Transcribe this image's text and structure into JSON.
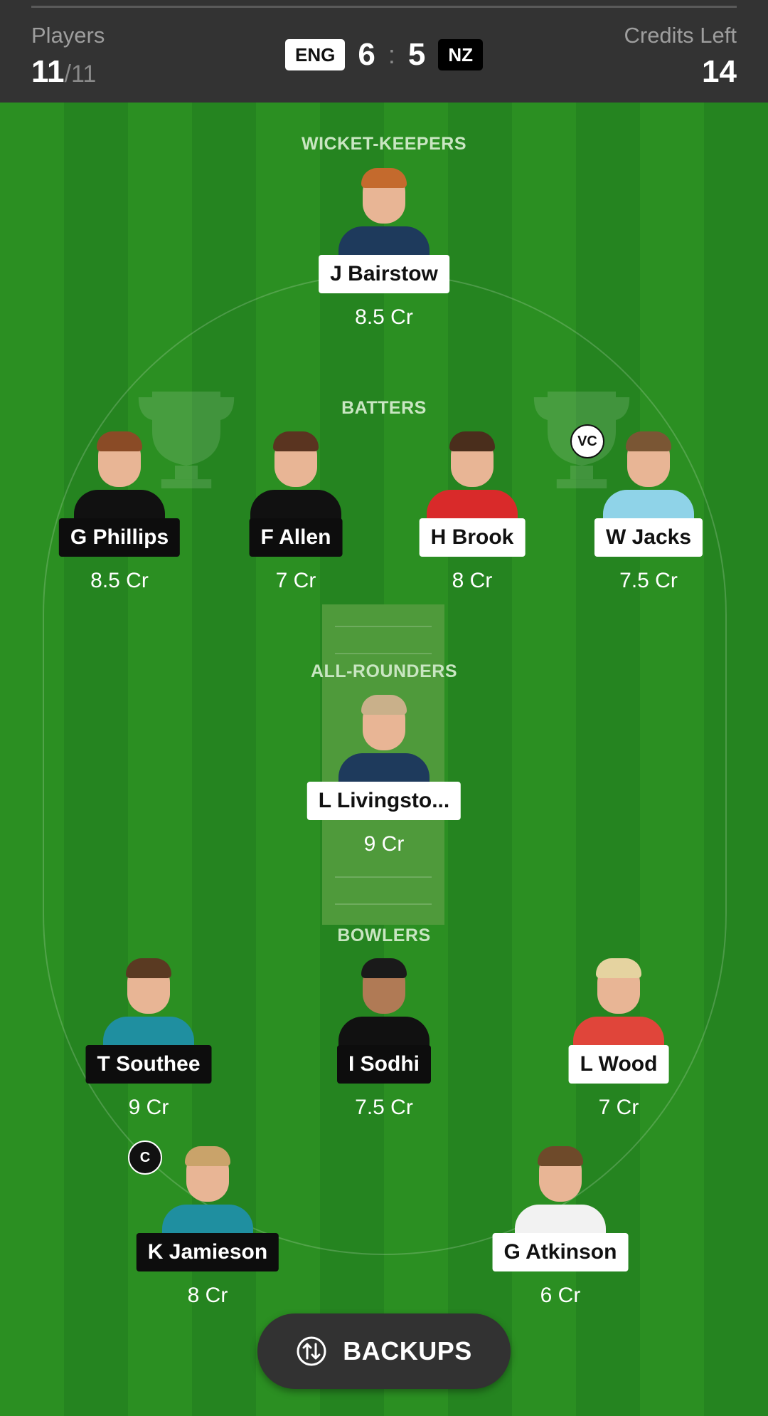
{
  "header": {
    "players_label": "Players",
    "players_selected": "11",
    "players_total": "/11",
    "credits_label": "Credits Left",
    "credits_value": "14",
    "team1": "ENG",
    "team1_count": "6",
    "separator": ":",
    "team2_count": "5",
    "team2": "NZ"
  },
  "sections": {
    "wicket_keepers": "WICKET-KEEPERS",
    "batters": "BATTERS",
    "all_rounders": "ALL-ROUNDERS",
    "bowlers": "BOWLERS"
  },
  "players": {
    "bairstow": {
      "name": "J Bairstow",
      "credits": "8.5 Cr"
    },
    "phillips": {
      "name": "G Phillips",
      "credits": "8.5 Cr"
    },
    "allen": {
      "name": "F Allen",
      "credits": "7 Cr"
    },
    "brook": {
      "name": "H Brook",
      "credits": "8 Cr"
    },
    "jacks": {
      "name": "W Jacks",
      "credits": "7.5 Cr",
      "role": "VC"
    },
    "livingstone": {
      "name": "L Livingsto...",
      "credits": "9 Cr"
    },
    "southee": {
      "name": "T Southee",
      "credits": "9 Cr"
    },
    "sodhi": {
      "name": "I Sodhi",
      "credits": "7.5 Cr"
    },
    "wood": {
      "name": "L Wood",
      "credits": "7 Cr"
    },
    "jamieson": {
      "name": "K Jamieson",
      "credits": "8 Cr",
      "role": "C"
    },
    "atkinson": {
      "name": "G Atkinson",
      "credits": "6 Cr"
    }
  },
  "backups_label": "BACKUPS",
  "colors": {
    "field_light": "#2b8f22",
    "field_dark": "#258420",
    "header_bg": "#333333",
    "eng_jersey": "#1e3a5c",
    "nz_jersey": "#111111"
  }
}
